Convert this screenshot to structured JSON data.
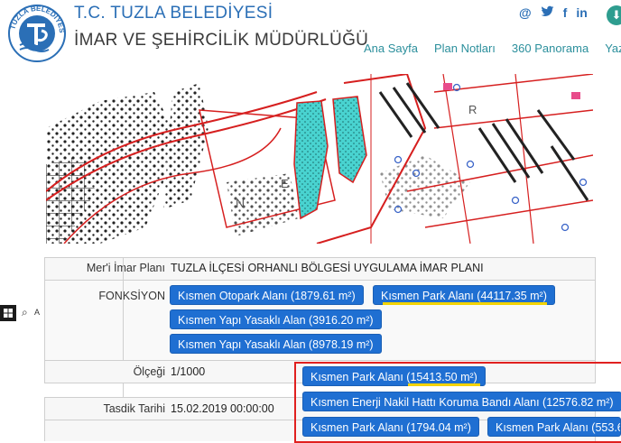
{
  "header": {
    "logo_text": "TUZLA BELEDİYESİ",
    "title": "T.C. TUZLA BELEDİYESİ",
    "subtitle": "İMAR VE ŞEHİRCİLİK MÜDÜRLÜĞÜ"
  },
  "social": {
    "at": "@",
    "twitter": "🐦",
    "facebook": "f",
    "linkedin": "in"
  },
  "nav": {
    "items": [
      "Ana Sayfa",
      "Plan Notları",
      "360 Panorama",
      "Yazdır"
    ]
  },
  "map": {
    "label_n": "N",
    "label_e": "E",
    "label_r": "R"
  },
  "info": {
    "plan_label": "Mer'i İmar Planı",
    "plan_value": "TUZLA İLÇESİ ORHANLI BÖLGESİ UYGULAMA İMAR PLANI",
    "fonksiyon_label": "FONKSİYON",
    "fonksiyon_buttons": [
      "Kısmen Otopark Alanı (1879.61 m²)",
      "Kısmen Park Alanı (44117.35 m²)",
      "Kısmen Yapı Yasaklı Alan (3916.20 m²)",
      "Kısmen Yapı Yasaklı Alan (8978.19 m²)"
    ],
    "olcek_label": "Ölçeği",
    "olcek_value": "1/1000",
    "tasdik_label": "Tasdik Tarihi",
    "tasdik_value": "15.02.2019 00:00:00"
  },
  "overlay": {
    "buttons": [
      "Kısmen Park Alanı (15413.50 m²)",
      "Kısmen Enerji Nakil Hattı Koruma Bandı Alanı (12576.82 m²)",
      "Kısmen Park Alanı (1794.04 m²)",
      "Kısmen Park Alanı (553.6"
    ]
  },
  "taskbar": {
    "search_icon": "⌕",
    "letter": "A"
  }
}
